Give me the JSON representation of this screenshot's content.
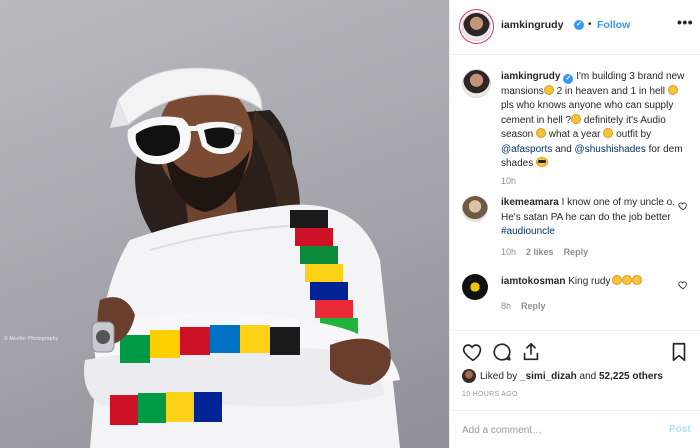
{
  "header": {
    "username": "iamkingrudy",
    "separator": "•",
    "follow_label": "Follow",
    "more_label": "•••"
  },
  "caption": {
    "username": "iamkingrudy",
    "segments": {
      "s1": " I'm building 3 brand new mansions",
      "s2": " 2 in heaven and 1 in hell ",
      "s3": " pls who knows anyone who can supply cement in hell ?",
      "s4": " definitely it's Audio season ",
      "s5": " what a year ",
      "s6": " outfit by ",
      "mention1": "@afasports",
      "s7": " and ",
      "mention2": "@shushishades",
      "s8": " for dem shades "
    },
    "time": "10h"
  },
  "comments": [
    {
      "username": "ikemeamara",
      "text": " I know one of my uncle o. He's satan PA he can do the job better ",
      "hashtag": "#audiouncle",
      "time": "10h",
      "likes": "2 likes",
      "reply_label": "Reply"
    },
    {
      "username": "iamtokosman",
      "text": " King rudy",
      "time": "8h",
      "reply_label": "Reply"
    }
  ],
  "actions": {
    "liked_by_prefix": "Liked by ",
    "liked_by_user": "_simi_dizah",
    "liked_by_and": " and ",
    "likes_count": "52,225 others",
    "time_ago": "10 HOURS AGO"
  },
  "add_comment": {
    "placeholder": "Add a comment…",
    "post_label": "Post"
  },
  "photo": {
    "watermark": "© Moofer Photography"
  },
  "colors": {
    "accent": "#3897f0",
    "text": "#262626",
    "muted": "#8e8e8e",
    "border": "#efefef",
    "link_dark": "#003569"
  }
}
